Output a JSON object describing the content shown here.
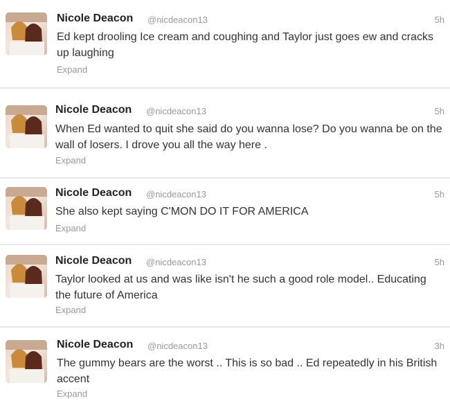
{
  "tweets": [
    {
      "name": "Nicole Deacon",
      "handle": "@nicdeacon13",
      "time": "5h",
      "text": "Ed kept drooling Ice cream and coughing and Taylor just goes ew and cracks up laughing",
      "expand": "Expand"
    },
    {
      "name": "Nicole Deacon",
      "handle": "@nicdeacon13",
      "time": "5h",
      "text": "When Ed wanted to quit she said do you wanna lose? Do you wanna be on the wall of losers. I drove you all the way here .",
      "expand": "Expand"
    },
    {
      "name": "Nicole Deacon",
      "handle": "@nicdeacon13",
      "time": "5h",
      "text": "She also kept saying C'MON DO IT FOR AMERICA",
      "expand": "Expand"
    },
    {
      "name": "Nicole Deacon",
      "handle": "@nicdeacon13",
      "time": "5h",
      "text": "Taylor looked at us and was like isn't he such a good role model.. Educating the future of America",
      "expand": "Expand"
    },
    {
      "name": "Nicole Deacon",
      "handle": "@nicdeacon13",
      "time": "3h",
      "text": "The gummy bears are the worst .. This is so bad .. Ed repeatedly in his British accent",
      "expand": "Expand"
    }
  ]
}
